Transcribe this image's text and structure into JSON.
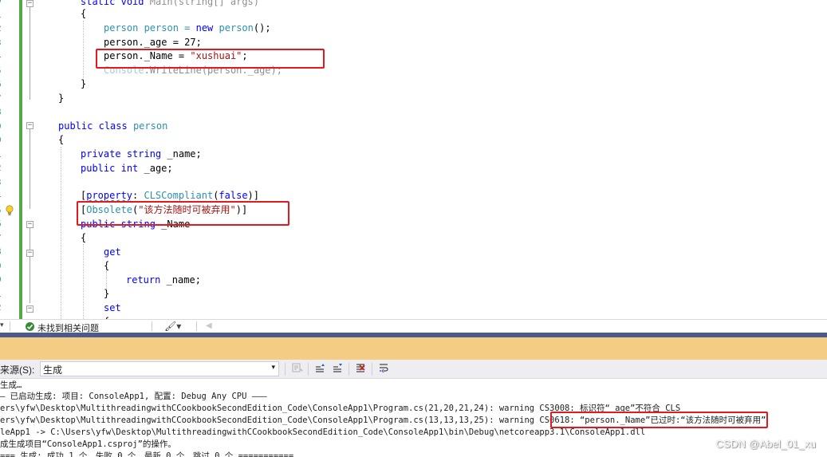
{
  "editor": {
    "line_numbers": [
      "0",
      "1",
      "2",
      "3",
      "4",
      "5",
      "6",
      "7",
      "8",
      "9",
      "0",
      "1",
      "2",
      "3",
      "4",
      "5",
      "6",
      "7",
      "8",
      "9",
      "0",
      "1",
      "2"
    ],
    "main_sig": {
      "kw_static": "static",
      "kw_void": "void",
      "name": "Main(string[] args)"
    },
    "brace_open_1": "{",
    "line_new_person": {
      "type": "person",
      "var": " person = ",
      "kw_new": "new",
      "ctor": " person",
      "rest": "();"
    },
    "line_age": "person._age = 27;",
    "line_name": {
      "lhs": "person._Name = ",
      "value": "\"xushuai\"",
      "end": ";"
    },
    "line_writeline": {
      "cls": "Console",
      "call": ".WriteLine(person._age);"
    },
    "brace_close_1": "}",
    "brace_close_2": "}",
    "class_decl": {
      "kw_public": "public",
      "kw_class": "class",
      "name": "person"
    },
    "brace_open_2": "{",
    "field_name": {
      "kw_private": "private",
      "kw_string": "string",
      "name": " _name;"
    },
    "field_age": {
      "kw_public": "public",
      "kw_int": "int",
      "name": " _age;"
    },
    "attr_property": {
      "open": "[",
      "target": "property",
      "colon": ": ",
      "attr": "CLSCompliant",
      "arg_open": "(",
      "arg": "false",
      "close": ")]"
    },
    "attr_obsolete": {
      "open": "[",
      "attr": "Obsolete",
      "arg_open": "(",
      "msg": "\"该方法随时可被弃用\"",
      "close": ")]"
    },
    "prop_decl": {
      "kw_public": "public",
      "kw_string": "string",
      "name": " _Name"
    },
    "brace_open_3": "{",
    "kw_get": "get",
    "brace_open_4": "{",
    "return_line": {
      "kw_return": "return",
      "rest": " _name;"
    },
    "brace_close_4": "}",
    "kw_set": "set",
    "brace_open_5": "{"
  },
  "editor_status": {
    "zoom_arrow": "▾",
    "issues_text": "未找到相关问题",
    "brush_glyph": "🖌▾",
    "nav_left": "◀"
  },
  "output": {
    "source_label": "显示输出来源(S):",
    "source_label_visible": "来源(S):",
    "source_value": "生成",
    "combo_arrow": "▾",
    "lines": [
      "生成…",
      "— 已启动生成: 项目: ConsoleApp1, 配置: Debug Any CPU ———",
      "ers\\yfw\\Desktop\\MultithreadingwithCCookbookSecondEdition_Code\\ConsoleApp1\\Program.cs(21,20,21,24): warning CS3008: 标识符“_age”不符合 CLS",
      "ers\\yfw\\Desktop\\MultithreadingwithCCookbookSecondEdition_Code\\ConsoleApp1\\Program.cs(13,13,13,25): warning CS0618: “person._Name”已过时:“该方法随时可被弃用”",
      "leApp1 -> C:\\Users\\yfw\\Desktop\\MultithreadingwithCCookbookSecondEdition_Code\\ConsoleApp1\\bin\\Debug\\netcoreapp3.1\\ConsoleApp1.dll",
      "成生成项目“ConsoleApp1.csproj”的操作。",
      "=== 生成: 成功 1 个，失败 0 个，最新 0 个，跳过 0 个 ==========="
    ]
  },
  "watermark": "CSDN @Abel_01_xu",
  "colors": {
    "keyword": "#0000ff",
    "type": "#2b91af",
    "string": "#a31515",
    "highlight_box": "#e3191e",
    "output_title": "#f5cc84",
    "divider": "#4b5b8f",
    "change_bar": "#57a64a"
  }
}
